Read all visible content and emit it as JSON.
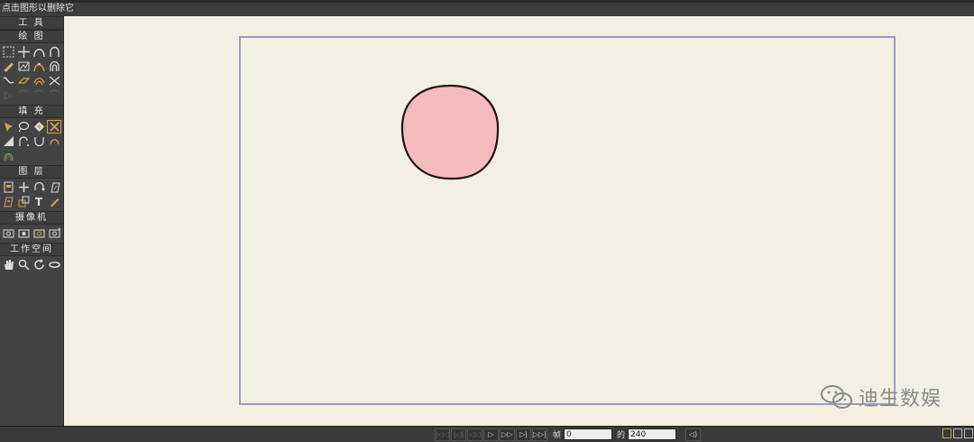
{
  "hint_bar": {
    "text": "点击图形以删除它"
  },
  "toolbox": {
    "sections": {
      "tools": "工 具",
      "draw": "绘 图",
      "fill": "填 充",
      "layers": "图 层",
      "camera": "摄像机",
      "workspace": "工作空间"
    },
    "layer_text_tool": "T"
  },
  "transport": {
    "frame_label": "帧",
    "frame_value": "0",
    "of_label": "的",
    "total_frames": "240"
  },
  "watermark": {
    "text": "迪生数娱"
  },
  "colors": {
    "workspace_bg": "#f1f0e2",
    "stage_border": "#9b9bc4",
    "shape_fill": "#f4bcbc",
    "shape_stroke": "#1f1111",
    "accent": "#d9a14a"
  }
}
